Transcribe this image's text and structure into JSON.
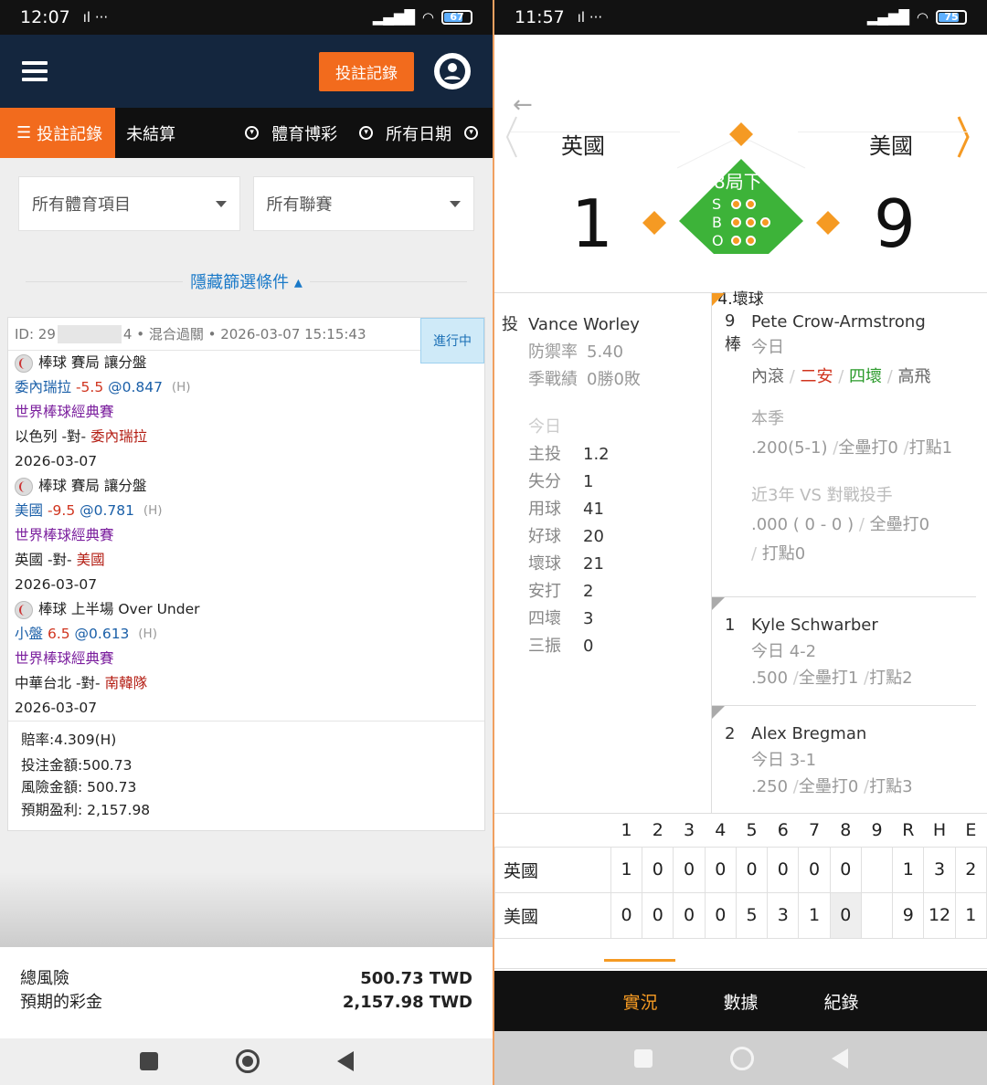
{
  "left": {
    "status": {
      "time": "12:07",
      "icons": "ıl ···",
      "battery": "67"
    },
    "header": {
      "record_button": "投註記錄"
    },
    "tabs": [
      {
        "label": "投註記錄",
        "active": true
      },
      {
        "label": "未結算"
      },
      {
        "label": "體育博彩"
      },
      {
        "label": "所有日期"
      }
    ],
    "filters": {
      "sport": "所有體育項目",
      "league": "所有聯賽"
    },
    "toggle_filters": "隱藏篩選條件 ▴",
    "bet": {
      "id_line": "ID: 29",
      "id_tail": "4 • 混合過關 • 2026-03-07 15:15:43",
      "status_badge": "進行中",
      "legs": [
        {
          "market": "棒球 賽局 讓分盤",
          "pick": "委內瑞拉",
          "line": "-5.5",
          "odds": "@0.847",
          "flag": "(H)",
          "league": "世界棒球經典賽",
          "home": "以色列",
          "vs": " -對- ",
          "away": "委內瑞拉",
          "date": "2026-03-07"
        },
        {
          "market": "棒球 賽局 讓分盤",
          "pick": "美國",
          "line": "-9.5",
          "odds": "@0.781",
          "flag": "(H)",
          "league": "世界棒球經典賽",
          "home": "英國",
          "vs": " -對- ",
          "away": "美國",
          "date": "2026-03-07"
        },
        {
          "market": "棒球 上半場 Over Under",
          "pick": "小盤",
          "line": "6.5",
          "odds": "@0.613",
          "flag": "(H)",
          "league": "世界棒球經典賽",
          "home": "中華台北",
          "vs": " -對- ",
          "away": "南韓隊",
          "date": "2026-03-07"
        }
      ],
      "odds_total": "賠率:4.309(H)",
      "stake": "投注金額:500.73",
      "risk": "風險金額: 500.73",
      "profit": "預期盈利: 2,157.98"
    },
    "totals": {
      "risk_label": "總風險",
      "risk_value": "500.73 TWD",
      "payout_label": "預期的彩金",
      "payout_value": "2,157.98 TWD"
    }
  },
  "right": {
    "status": {
      "time": "11:57",
      "icons": "ıl ···",
      "battery": "75"
    },
    "teams": {
      "away": "英國",
      "home": "美國",
      "away_score": "1",
      "home_score": "9"
    },
    "inning": "8局下",
    "count": {
      "S": "S",
      "B": "B",
      "O": "O",
      "balls": 3,
      "strikes": 2,
      "outs": 2
    },
    "state": "4.壞球",
    "pitcher": {
      "label": "投",
      "name": "Vance Worley",
      "era_label": "防禦率",
      "era": "5.40",
      "record_label": "季戰績",
      "record": "0勝0敗",
      "today_label": "今日",
      "stats": [
        {
          "k": "主投",
          "v": "1.2"
        },
        {
          "k": "失分",
          "v": "1"
        },
        {
          "k": "用球",
          "v": "41"
        },
        {
          "k": "好球",
          "v": "20"
        },
        {
          "k": "壞球",
          "v": "21"
        },
        {
          "k": "安打",
          "v": "2"
        },
        {
          "k": "四壞",
          "v": "3"
        },
        {
          "k": "三振",
          "v": "0"
        }
      ]
    },
    "batters": [
      {
        "order": "9",
        "pos": "棒",
        "name": "Pete Crow-Armstrong",
        "today_label": "今日",
        "today": [
          "內滾",
          "二安",
          "四壞",
          "高飛"
        ],
        "season_label": "本季",
        "season": ".200(5-1)",
        "season_hr": "全壘打0",
        "season_rbi": "打點1",
        "vs_label": "近3年 VS 對戰投手",
        "vs": ".000 ( 0 - 0 )",
        "vs_hr": "全壘打0",
        "vs_rbi": "打點0"
      },
      {
        "order": "1",
        "name": "Kyle Schwarber",
        "today": "今日 4-2",
        "avg": ".500",
        "hr": "全壘打1",
        "rbi": "打點2"
      },
      {
        "order": "2",
        "name": "Alex Bregman",
        "today": "今日 3-1",
        "avg": ".250",
        "hr": "全壘打0",
        "rbi": "打點3"
      }
    ],
    "boxscore": {
      "headers": [
        "1",
        "2",
        "3",
        "4",
        "5",
        "6",
        "7",
        "8",
        "9",
        "R",
        "H",
        "E"
      ],
      "rows": [
        {
          "team": "英國",
          "cells": [
            "1",
            "0",
            "0",
            "0",
            "0",
            "0",
            "0",
            "0",
            "",
            "1",
            "3",
            "2"
          ]
        },
        {
          "team": "美國",
          "cells": [
            "0",
            "0",
            "0",
            "0",
            "5",
            "3",
            "1",
            "0",
            "",
            "9",
            "12",
            "1"
          ]
        }
      ]
    },
    "bottom_tabs": [
      {
        "label": "實況",
        "active": true
      },
      {
        "label": "數據"
      },
      {
        "label": "紀錄"
      }
    ]
  }
}
